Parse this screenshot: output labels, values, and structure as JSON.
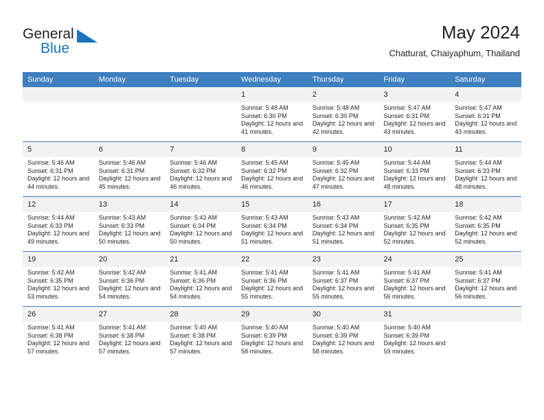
{
  "brand": {
    "name_top": "General",
    "name_bottom": "Blue",
    "accent_color": "#1b75bc"
  },
  "header": {
    "title": "May 2024",
    "subtitle": "Chatturat, Chaiyaphum, Thailand"
  },
  "theme": {
    "header_bar_color": "#3d7fbf",
    "daynum_band_color": "#f2f2f2",
    "text_color": "#231f20"
  },
  "calendar": {
    "weekday_headers": [
      "Sunday",
      "Monday",
      "Tuesday",
      "Wednesday",
      "Thursday",
      "Friday",
      "Saturday"
    ],
    "weeks": [
      [
        {
          "day": "",
          "blank": true
        },
        {
          "day": "",
          "blank": true
        },
        {
          "day": "",
          "blank": true
        },
        {
          "day": "1",
          "sunrise": "Sunrise: 5:48 AM",
          "sunset": "Sunset: 6:30 PM",
          "daylight": "Daylight: 12 hours and 41 minutes."
        },
        {
          "day": "2",
          "sunrise": "Sunrise: 5:48 AM",
          "sunset": "Sunset: 6:30 PM",
          "daylight": "Daylight: 12 hours and 42 minutes."
        },
        {
          "day": "3",
          "sunrise": "Sunrise: 5:47 AM",
          "sunset": "Sunset: 6:31 PM",
          "daylight": "Daylight: 12 hours and 43 minutes."
        },
        {
          "day": "4",
          "sunrise": "Sunrise: 5:47 AM",
          "sunset": "Sunset: 6:31 PM",
          "daylight": "Daylight: 12 hours and 43 minutes."
        }
      ],
      [
        {
          "day": "5",
          "sunrise": "Sunrise: 5:46 AM",
          "sunset": "Sunset: 6:31 PM",
          "daylight": "Daylight: 12 hours and 44 minutes."
        },
        {
          "day": "6",
          "sunrise": "Sunrise: 5:46 AM",
          "sunset": "Sunset: 6:31 PM",
          "daylight": "Daylight: 12 hours and 45 minutes."
        },
        {
          "day": "7",
          "sunrise": "Sunrise: 5:46 AM",
          "sunset": "Sunset: 6:32 PM",
          "daylight": "Daylight: 12 hours and 46 minutes."
        },
        {
          "day": "8",
          "sunrise": "Sunrise: 5:45 AM",
          "sunset": "Sunset: 6:32 PM",
          "daylight": "Daylight: 12 hours and 46 minutes."
        },
        {
          "day": "9",
          "sunrise": "Sunrise: 5:45 AM",
          "sunset": "Sunset: 6:32 PM",
          "daylight": "Daylight: 12 hours and 47 minutes."
        },
        {
          "day": "10",
          "sunrise": "Sunrise: 5:44 AM",
          "sunset": "Sunset: 6:33 PM",
          "daylight": "Daylight: 12 hours and 48 minutes."
        },
        {
          "day": "11",
          "sunrise": "Sunrise: 5:44 AM",
          "sunset": "Sunset: 6:33 PM",
          "daylight": "Daylight: 12 hours and 48 minutes."
        }
      ],
      [
        {
          "day": "12",
          "sunrise": "Sunrise: 5:44 AM",
          "sunset": "Sunset: 6:33 PM",
          "daylight": "Daylight: 12 hours and 49 minutes."
        },
        {
          "day": "13",
          "sunrise": "Sunrise: 5:43 AM",
          "sunset": "Sunset: 6:33 PM",
          "daylight": "Daylight: 12 hours and 50 minutes."
        },
        {
          "day": "14",
          "sunrise": "Sunrise: 5:43 AM",
          "sunset": "Sunset: 6:34 PM",
          "daylight": "Daylight: 12 hours and 50 minutes."
        },
        {
          "day": "15",
          "sunrise": "Sunrise: 5:43 AM",
          "sunset": "Sunset: 6:34 PM",
          "daylight": "Daylight: 12 hours and 51 minutes."
        },
        {
          "day": "16",
          "sunrise": "Sunrise: 5:43 AM",
          "sunset": "Sunset: 6:34 PM",
          "daylight": "Daylight: 12 hours and 51 minutes."
        },
        {
          "day": "17",
          "sunrise": "Sunrise: 5:42 AM",
          "sunset": "Sunset: 6:35 PM",
          "daylight": "Daylight: 12 hours and 52 minutes."
        },
        {
          "day": "18",
          "sunrise": "Sunrise: 5:42 AM",
          "sunset": "Sunset: 6:35 PM",
          "daylight": "Daylight: 12 hours and 52 minutes."
        }
      ],
      [
        {
          "day": "19",
          "sunrise": "Sunrise: 5:42 AM",
          "sunset": "Sunset: 6:35 PM",
          "daylight": "Daylight: 12 hours and 53 minutes."
        },
        {
          "day": "20",
          "sunrise": "Sunrise: 5:42 AM",
          "sunset": "Sunset: 6:36 PM",
          "daylight": "Daylight: 12 hours and 54 minutes."
        },
        {
          "day": "21",
          "sunrise": "Sunrise: 5:41 AM",
          "sunset": "Sunset: 6:36 PM",
          "daylight": "Daylight: 12 hours and 54 minutes."
        },
        {
          "day": "22",
          "sunrise": "Sunrise: 5:41 AM",
          "sunset": "Sunset: 6:36 PM",
          "daylight": "Daylight: 12 hours and 55 minutes."
        },
        {
          "day": "23",
          "sunrise": "Sunrise: 5:41 AM",
          "sunset": "Sunset: 6:37 PM",
          "daylight": "Daylight: 12 hours and 55 minutes."
        },
        {
          "day": "24",
          "sunrise": "Sunrise: 5:41 AM",
          "sunset": "Sunset: 6:37 PM",
          "daylight": "Daylight: 12 hours and 56 minutes."
        },
        {
          "day": "25",
          "sunrise": "Sunrise: 5:41 AM",
          "sunset": "Sunset: 6:37 PM",
          "daylight": "Daylight: 12 hours and 56 minutes."
        }
      ],
      [
        {
          "day": "26",
          "sunrise": "Sunrise: 5:41 AM",
          "sunset": "Sunset: 6:38 PM",
          "daylight": "Daylight: 12 hours and 57 minutes."
        },
        {
          "day": "27",
          "sunrise": "Sunrise: 5:41 AM",
          "sunset": "Sunset: 6:38 PM",
          "daylight": "Daylight: 12 hours and 57 minutes."
        },
        {
          "day": "28",
          "sunrise": "Sunrise: 5:40 AM",
          "sunset": "Sunset: 6:38 PM",
          "daylight": "Daylight: 12 hours and 57 minutes."
        },
        {
          "day": "29",
          "sunrise": "Sunrise: 5:40 AM",
          "sunset": "Sunset: 6:39 PM",
          "daylight": "Daylight: 12 hours and 58 minutes."
        },
        {
          "day": "30",
          "sunrise": "Sunrise: 5:40 AM",
          "sunset": "Sunset: 6:39 PM",
          "daylight": "Daylight: 12 hours and 58 minutes."
        },
        {
          "day": "31",
          "sunrise": "Sunrise: 5:40 AM",
          "sunset": "Sunset: 6:39 PM",
          "daylight": "Daylight: 12 hours and 59 minutes."
        },
        {
          "day": "",
          "blank": true
        }
      ]
    ]
  }
}
